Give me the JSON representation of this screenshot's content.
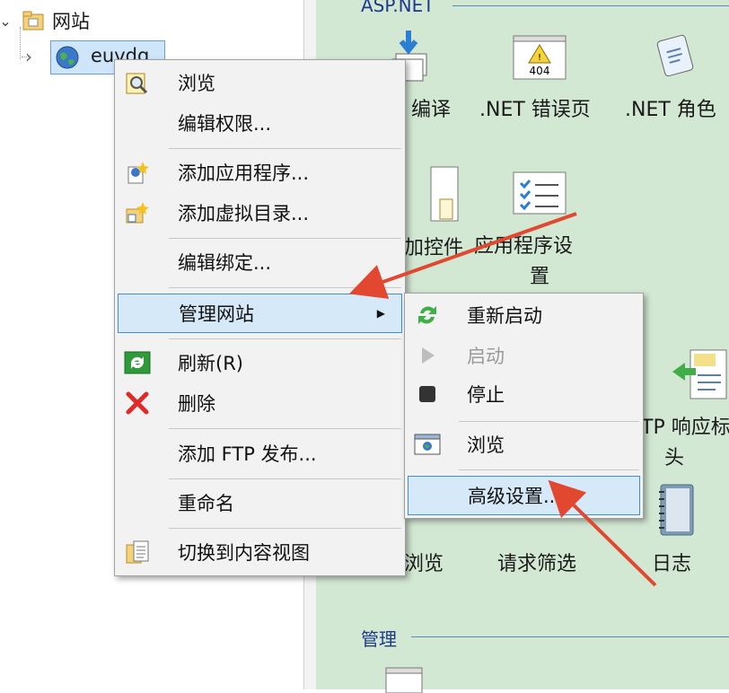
{
  "tree": {
    "root_label": "网站",
    "site_label": "euvdq"
  },
  "features": {
    "group_aspnet": "ASP.NET",
    "group_manage": "管理",
    "items": {
      "compile": "编译",
      "net_error": ".NET 错误页",
      "net_role": ".NET 角色",
      "controls": "加控件",
      "app_settings": "应用程序设",
      "app_settings_2": "置",
      "http_headers": "TP 响应标",
      "http_headers_2": "头",
      "browse": "浏览",
      "request_filter": "请求筛选",
      "logging": "日志"
    },
    "warning_code": "404"
  },
  "context_menu": {
    "browse": "浏览",
    "edit_permissions": "编辑权限...",
    "add_application": "添加应用程序...",
    "add_virtual_dir": "添加虚拟目录...",
    "edit_bindings": "编辑绑定...",
    "manage_website": "管理网站",
    "refresh": "刷新(R)",
    "delete": "删除",
    "add_ftp": "添加 FTP 发布...",
    "rename": "重命名",
    "switch_content_view": "切换到内容视图"
  },
  "submenu": {
    "restart": "重新启动",
    "start": "启动",
    "stop": "停止",
    "browse": "浏览",
    "advanced_settings": "高级设置..."
  },
  "colors": {
    "features_bg": "#d2e8d3",
    "highlight": "#d6e9f9",
    "annotation_arrow": "#e2472f"
  }
}
